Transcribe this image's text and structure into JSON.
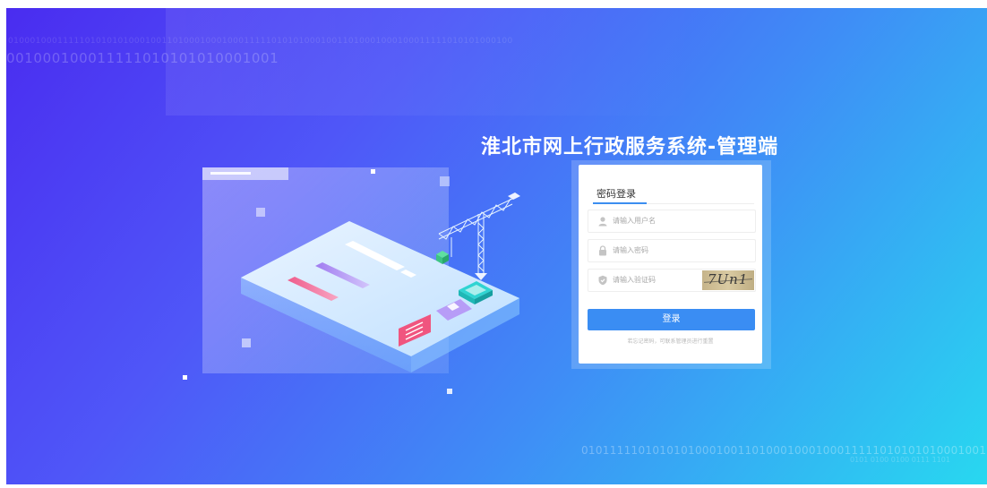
{
  "header": {
    "system_title": "淮北市网上行政服务系统-管理端"
  },
  "background": {
    "binary_top_small": "01000100011111010101010001001101000100010001111101010100010011010001000100011111010101000100",
    "binary_top_large": "001000100011111010101010001001",
    "binary_bottom": "010111110101010100010011010001000100011111010101010001001",
    "binary_bottom_fade": "0101 0100 0100 0111 1101"
  },
  "login": {
    "tab_label": "密码登录",
    "username_placeholder": "请输入用户名",
    "password_placeholder": "请输入密码",
    "captcha_placeholder": "请输入验证码",
    "captcha_text": "7Un1",
    "login_button": "登录",
    "hint_text": "若忘记密码，可联系管理员进行重置"
  },
  "icons": {
    "username": "user-icon",
    "password": "lock-icon",
    "captcha": "shield-icon"
  },
  "colors": {
    "accent": "#3a8df3",
    "gradient_start": "#4a2cf0",
    "gradient_end": "#28d8f0"
  }
}
